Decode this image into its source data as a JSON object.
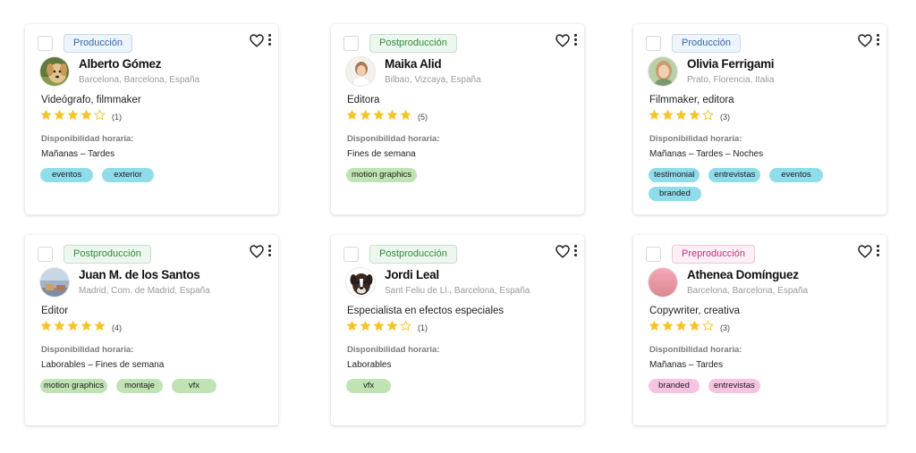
{
  "colors": {
    "star_filled": "#f7c325",
    "star_empty": "#c9c9c9",
    "tag_blue": "#8fdceb",
    "tag_green": "#bfe3b3",
    "tag_pink": "#f7c3e2"
  },
  "availability_label": "Disponibilidad horaria:",
  "cards": [
    {
      "stage": "Producción",
      "name": "Alberto Gómez",
      "location": "Barcelona, Barcelona, España",
      "role": "Videógrafo, filmmaker",
      "rating": 4,
      "rating_max": 5,
      "reviews": "(1)",
      "availability": "Mañanas – Tardes",
      "avatar": "dog-golden-photo",
      "tags": [
        "eventos",
        "exterior"
      ]
    },
    {
      "stage": "Postproducción",
      "name": "Maika Alid",
      "location": "Bilbao, Vizcaya, España",
      "role": "Editora",
      "rating": 5,
      "rating_max": 5,
      "reviews": "(5)",
      "availability": "Fines de semana",
      "avatar": "woman-portrait-light",
      "tags": [
        "motion graphics"
      ]
    },
    {
      "stage": "Producción",
      "name": "Olivia Ferrigami",
      "location": "Prato, Florencia, Italia",
      "role": "Filmmaker, editora",
      "rating": 4,
      "rating_max": 5,
      "reviews": "(3)",
      "availability": "Mañanas – Tardes – Noches",
      "avatar": "woman-portrait-green",
      "tags": [
        "testimonial",
        "entrevistas",
        "eventos",
        "branded"
      ]
    },
    {
      "stage": "Postproducción",
      "name": "Juan M. de los Santos",
      "location": "Madrid, Com. de Madrid, España",
      "role": "Editor",
      "rating": 5,
      "rating_max": 5,
      "reviews": "(4)",
      "availability": "Laborables – Fines de semana",
      "avatar": "landscape-photo",
      "tags": [
        "motion graphics",
        "montaje",
        "vfx"
      ]
    },
    {
      "stage": "Postproducción",
      "name": "Jordi Leal",
      "location": "Sant Feliu de Ll., Barcelona, España",
      "role": "Especialista en efectos especiales",
      "rating": 4,
      "rating_max": 5,
      "reviews": "(1)",
      "availability": "Laborables",
      "avatar": "dog-boxer-photo",
      "tags": [
        "vfx"
      ]
    },
    {
      "stage": "Preproducción",
      "name": "Athenea Domínguez",
      "location": "Barcelona, Barcelona, España",
      "role": "Copywriter, creativa",
      "rating": 4,
      "rating_max": 5,
      "reviews": "(3)",
      "availability": "Mañanas – Tardes",
      "avatar": "pink-gradient",
      "tags": [
        "branded",
        "entrevistas"
      ]
    }
  ]
}
